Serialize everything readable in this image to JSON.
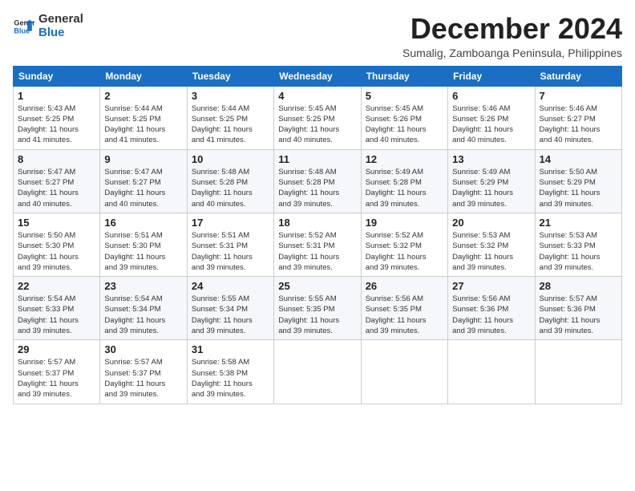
{
  "logo": {
    "line1": "General",
    "line2": "Blue"
  },
  "title": "December 2024",
  "subtitle": "Sumalig, Zamboanga Peninsula, Philippines",
  "days_header": [
    "Sunday",
    "Monday",
    "Tuesday",
    "Wednesday",
    "Thursday",
    "Friday",
    "Saturday"
  ],
  "weeks": [
    [
      {
        "day": "1",
        "sunrise": "5:43 AM",
        "sunset": "5:25 PM",
        "daylight": "11 hours and 41 minutes."
      },
      {
        "day": "2",
        "sunrise": "5:44 AM",
        "sunset": "5:25 PM",
        "daylight": "11 hours and 41 minutes."
      },
      {
        "day": "3",
        "sunrise": "5:44 AM",
        "sunset": "5:25 PM",
        "daylight": "11 hours and 41 minutes."
      },
      {
        "day": "4",
        "sunrise": "5:45 AM",
        "sunset": "5:25 PM",
        "daylight": "11 hours and 40 minutes."
      },
      {
        "day": "5",
        "sunrise": "5:45 AM",
        "sunset": "5:26 PM",
        "daylight": "11 hours and 40 minutes."
      },
      {
        "day": "6",
        "sunrise": "5:46 AM",
        "sunset": "5:26 PM",
        "daylight": "11 hours and 40 minutes."
      },
      {
        "day": "7",
        "sunrise": "5:46 AM",
        "sunset": "5:27 PM",
        "daylight": "11 hours and 40 minutes."
      }
    ],
    [
      {
        "day": "8",
        "sunrise": "5:47 AM",
        "sunset": "5:27 PM",
        "daylight": "11 hours and 40 minutes."
      },
      {
        "day": "9",
        "sunrise": "5:47 AM",
        "sunset": "5:27 PM",
        "daylight": "11 hours and 40 minutes."
      },
      {
        "day": "10",
        "sunrise": "5:48 AM",
        "sunset": "5:28 PM",
        "daylight": "11 hours and 40 minutes."
      },
      {
        "day": "11",
        "sunrise": "5:48 AM",
        "sunset": "5:28 PM",
        "daylight": "11 hours and 39 minutes."
      },
      {
        "day": "12",
        "sunrise": "5:49 AM",
        "sunset": "5:28 PM",
        "daylight": "11 hours and 39 minutes."
      },
      {
        "day": "13",
        "sunrise": "5:49 AM",
        "sunset": "5:29 PM",
        "daylight": "11 hours and 39 minutes."
      },
      {
        "day": "14",
        "sunrise": "5:50 AM",
        "sunset": "5:29 PM",
        "daylight": "11 hours and 39 minutes."
      }
    ],
    [
      {
        "day": "15",
        "sunrise": "5:50 AM",
        "sunset": "5:30 PM",
        "daylight": "11 hours and 39 minutes."
      },
      {
        "day": "16",
        "sunrise": "5:51 AM",
        "sunset": "5:30 PM",
        "daylight": "11 hours and 39 minutes."
      },
      {
        "day": "17",
        "sunrise": "5:51 AM",
        "sunset": "5:31 PM",
        "daylight": "11 hours and 39 minutes."
      },
      {
        "day": "18",
        "sunrise": "5:52 AM",
        "sunset": "5:31 PM",
        "daylight": "11 hours and 39 minutes."
      },
      {
        "day": "19",
        "sunrise": "5:52 AM",
        "sunset": "5:32 PM",
        "daylight": "11 hours and 39 minutes."
      },
      {
        "day": "20",
        "sunrise": "5:53 AM",
        "sunset": "5:32 PM",
        "daylight": "11 hours and 39 minutes."
      },
      {
        "day": "21",
        "sunrise": "5:53 AM",
        "sunset": "5:33 PM",
        "daylight": "11 hours and 39 minutes."
      }
    ],
    [
      {
        "day": "22",
        "sunrise": "5:54 AM",
        "sunset": "5:33 PM",
        "daylight": "11 hours and 39 minutes."
      },
      {
        "day": "23",
        "sunrise": "5:54 AM",
        "sunset": "5:34 PM",
        "daylight": "11 hours and 39 minutes."
      },
      {
        "day": "24",
        "sunrise": "5:55 AM",
        "sunset": "5:34 PM",
        "daylight": "11 hours and 39 minutes."
      },
      {
        "day": "25",
        "sunrise": "5:55 AM",
        "sunset": "5:35 PM",
        "daylight": "11 hours and 39 minutes."
      },
      {
        "day": "26",
        "sunrise": "5:56 AM",
        "sunset": "5:35 PM",
        "daylight": "11 hours and 39 minutes."
      },
      {
        "day": "27",
        "sunrise": "5:56 AM",
        "sunset": "5:36 PM",
        "daylight": "11 hours and 39 minutes."
      },
      {
        "day": "28",
        "sunrise": "5:57 AM",
        "sunset": "5:36 PM",
        "daylight": "11 hours and 39 minutes."
      }
    ],
    [
      {
        "day": "29",
        "sunrise": "5:57 AM",
        "sunset": "5:37 PM",
        "daylight": "11 hours and 39 minutes."
      },
      {
        "day": "30",
        "sunrise": "5:57 AM",
        "sunset": "5:37 PM",
        "daylight": "11 hours and 39 minutes."
      },
      {
        "day": "31",
        "sunrise": "5:58 AM",
        "sunset": "5:38 PM",
        "daylight": "11 hours and 39 minutes."
      },
      null,
      null,
      null,
      null
    ]
  ]
}
